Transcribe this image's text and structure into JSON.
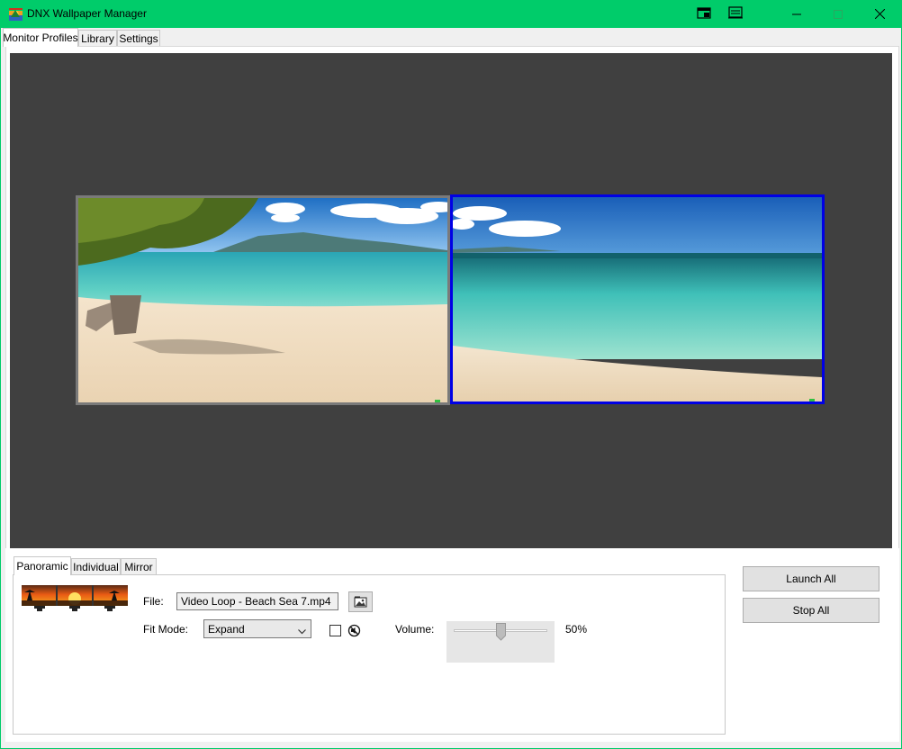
{
  "window": {
    "title": "DNX Wallpaper Manager",
    "accent_color": "#00cc6a",
    "title_icons": [
      "wallpaper-app-icon",
      "pin-window-icon",
      "layout-icon",
      "minimize-icon",
      "maximize-icon",
      "close-icon"
    ]
  },
  "main_tabs": [
    {
      "label": "Monitor Profiles",
      "active": true
    },
    {
      "label": "Library",
      "active": false
    },
    {
      "label": "Settings",
      "active": false
    }
  ],
  "preview": {
    "background_color": "#404040",
    "selected_border_color": "#0000e6",
    "monitors": [
      {
        "name": "monitor-1",
        "selected": false
      },
      {
        "name": "monitor-2",
        "selected": true
      }
    ]
  },
  "sub_tabs": [
    {
      "label": "Panoramic",
      "active": true
    },
    {
      "label": "Individual",
      "active": false
    },
    {
      "label": "Mirror",
      "active": false
    }
  ],
  "form": {
    "file_label": "File:",
    "file_value": "Video Loop - Beach Sea 7.mp4",
    "fit_mode_label": "Fit Mode:",
    "fit_mode_value": "Expand",
    "volume_label": "Volume:",
    "volume_fraction": 0.5,
    "volume_text": "50%",
    "mute_checked": false
  },
  "actions": {
    "launch_all": "Launch All",
    "stop_all": "Stop All"
  }
}
